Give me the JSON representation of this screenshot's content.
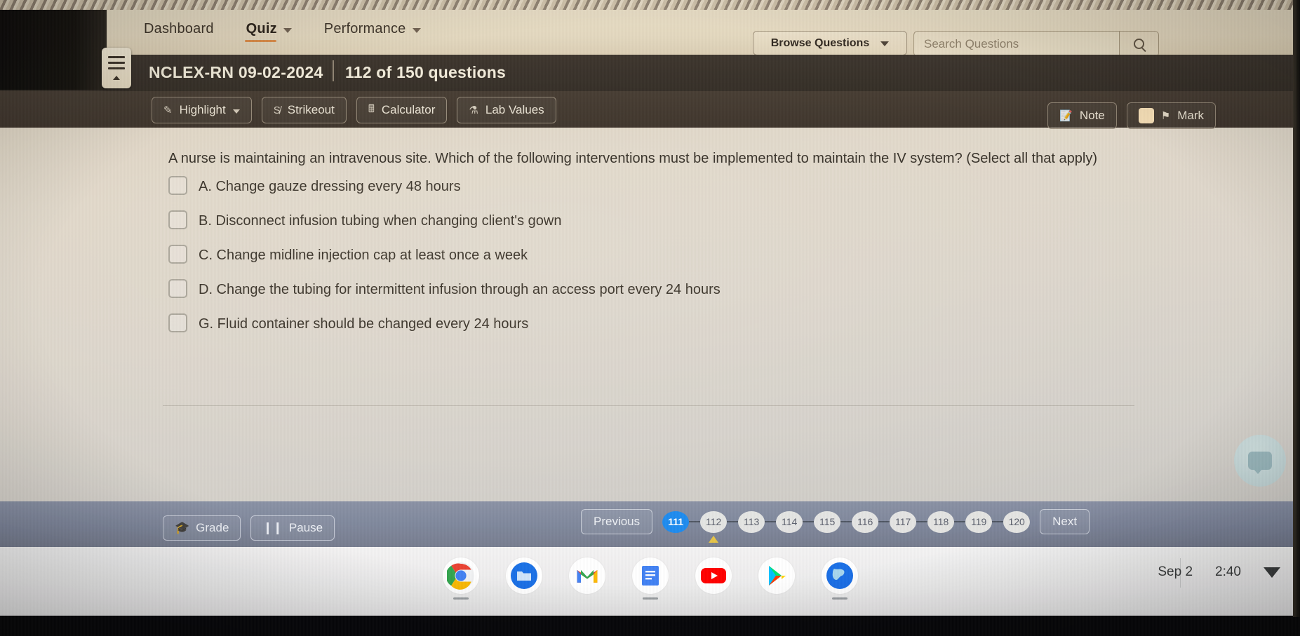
{
  "site_nav": {
    "items": [
      {
        "label": "Dashboard",
        "has_caret": false,
        "active": false
      },
      {
        "label": "Quiz",
        "has_caret": true,
        "active": true
      },
      {
        "label": "Performance",
        "has_caret": true,
        "active": false
      }
    ],
    "browse_button": "Browse Questions",
    "search_placeholder": "Search Questions",
    "search_value": ""
  },
  "app_header": {
    "menu_icon": "hamburger-icon",
    "quiz_title": "NCLEX-RN 09-02-2024",
    "question_count": "112 of 150 questions"
  },
  "toolbar": {
    "left_tools": [
      {
        "label": "Highlight",
        "icon": "highlighter-icon",
        "caret": true
      },
      {
        "label": "Strikeout",
        "icon": "strikethrough-icon",
        "caret": false
      },
      {
        "label": "Calculator",
        "icon": "calculator-icon",
        "caret": false
      },
      {
        "label": "Lab Values",
        "icon": "flask-icon",
        "caret": false
      }
    ],
    "right_tools": [
      {
        "label": "Note",
        "icon": "note-icon"
      },
      {
        "label": "Mark",
        "icon": "flag-icon",
        "swatch": "#f3dcb6"
      }
    ]
  },
  "question": {
    "text": "A nurse is maintaining an intravenous site. Which of the following interventions must be implemented to maintain the IV system? (Select all that apply)",
    "options": [
      {
        "id": "A",
        "label": "A. Change gauze dressing every 48 hours",
        "checked": false
      },
      {
        "id": "B",
        "label": "B. Disconnect infusion tubing when changing client's gown",
        "checked": false
      },
      {
        "id": "C",
        "label": "C. Change midline injection cap at least once a week",
        "checked": false
      },
      {
        "id": "D",
        "label": "D. Change the tubing for intermittent infusion through an access port every 24 hours",
        "checked": false
      },
      {
        "id": "G",
        "label": "G. Fluid container should be changed every 24 hours",
        "checked": false
      }
    ],
    "submit_label": "Next"
  },
  "quiz_nav": {
    "grade_label": "Grade",
    "pause_label": "Pause",
    "previous_label": "Previous",
    "next_label": "Next",
    "current_page": "111",
    "pages": [
      "111",
      "112",
      "113",
      "114",
      "115",
      "116",
      "117",
      "118",
      "119",
      "120"
    ],
    "marked_page": "112"
  },
  "shelf": {
    "apps": [
      {
        "name": "chrome-icon",
        "active": true
      },
      {
        "name": "files-icon",
        "active": false
      },
      {
        "name": "gmail-icon",
        "active": false
      },
      {
        "name": "docs-icon",
        "active": true
      },
      {
        "name": "youtube-icon",
        "active": false
      },
      {
        "name": "play-store-icon",
        "active": false
      },
      {
        "name": "maps-icon",
        "active": true
      }
    ],
    "date": "Sep 2",
    "time": "2:40",
    "status_icon": "wifi-icon"
  },
  "colors": {
    "accent_blue": "#1e8cf0",
    "primary_button": "#4a57b0",
    "nav_active_underline": "#d98a4a",
    "mark_swatch": "#f3dcb6",
    "marked_indicator": "#e6c54a"
  }
}
